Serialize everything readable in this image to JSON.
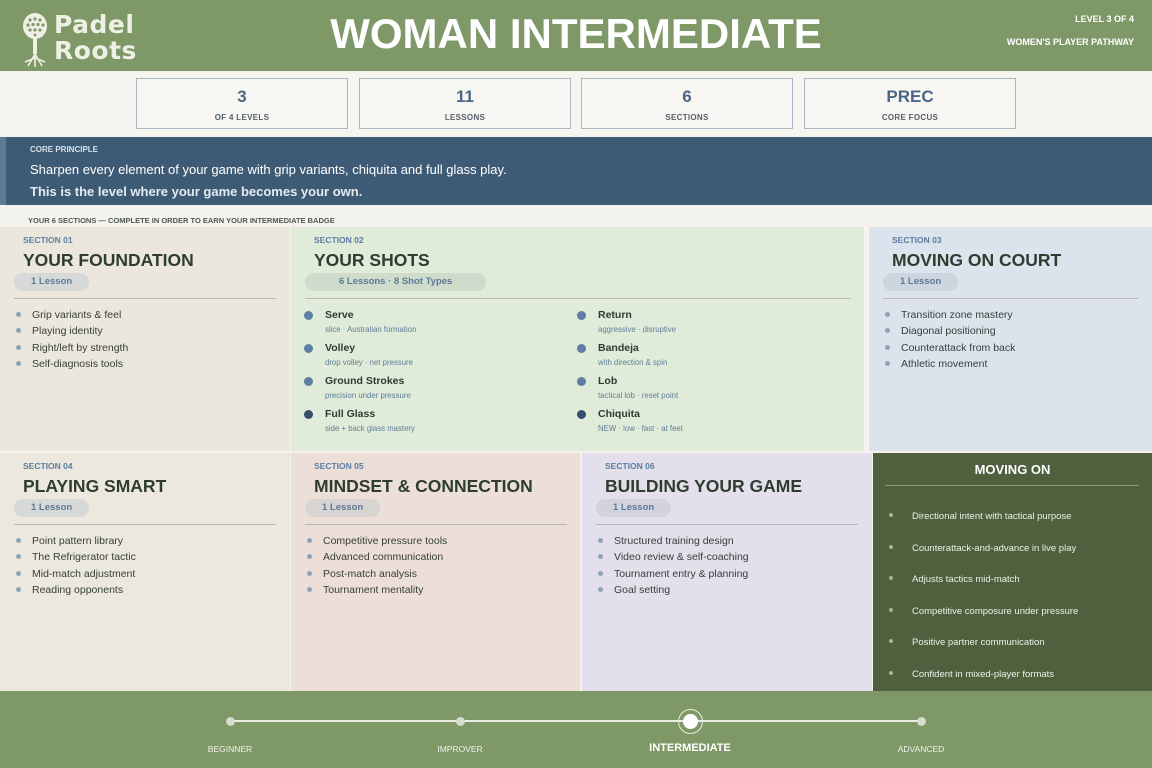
{
  "header": {
    "brand_line1": "Padel",
    "brand_line2": "Roots",
    "title": "WOMAN INTERMEDIATE",
    "level_tag": "LEVEL 3 OF 4",
    "pathway_tag": "WOMEN'S PLAYER PATHWAY"
  },
  "stats": [
    {
      "value": "3",
      "label": "OF 4 LEVELS"
    },
    {
      "value": "11",
      "label": "LESSONS"
    },
    {
      "value": "6",
      "label": "SECTIONS"
    },
    {
      "value": "PREC",
      "label": "CORE FOCUS"
    }
  ],
  "core": {
    "label": "CORE PRINCIPLE",
    "text": "Sharpen every element of your game with grip variants, chiquita and full glass play.",
    "emphasis": "This is the level where your game becomes your own."
  },
  "sections_intro": "YOUR 6 SECTIONS — COMPLETE IN ORDER TO EARN YOUR INTERMEDIATE BADGE",
  "sections": [
    {
      "num": "SECTION 01",
      "title": "YOUR FOUNDATION",
      "lessons": "1 Lesson",
      "items": [
        "Grip variants & feel",
        "Playing identity",
        "Right/left by strength",
        "Self-diagnosis tools"
      ]
    },
    {
      "num": "SECTION 02",
      "title": "YOUR SHOTS",
      "lessons": "6 Lessons · 8 Shot Types",
      "shots": [
        {
          "name": "Serve",
          "note": "slice · Australian formation"
        },
        {
          "name": "Return",
          "note": "aggressive · disruptive"
        },
        {
          "name": "Volley",
          "note": "drop volley · net pressure"
        },
        {
          "name": "Bandeja",
          "note": "with direction & spin"
        },
        {
          "name": "Ground Strokes",
          "note": "precision under pressure"
        },
        {
          "name": "Lob",
          "note": "tactical lob · reset point"
        },
        {
          "name": "Full Glass",
          "note": "side + back glass mastery"
        },
        {
          "name": "Chiquita",
          "note": "NEW · low · fast · at feet"
        }
      ]
    },
    {
      "num": "SECTION 03",
      "title": "MOVING ON COURT",
      "lessons": "1 Lesson",
      "items": [
        "Transition zone mastery",
        "Diagonal positioning",
        "Counterattack from back",
        "Athletic movement"
      ]
    },
    {
      "num": "SECTION 04",
      "title": "PLAYING SMART",
      "lessons": "1 Lesson",
      "items": [
        "Point pattern library",
        "The Refrigerator tactic",
        "Mid-match adjustment",
        "Reading opponents"
      ]
    },
    {
      "num": "SECTION 05",
      "title": "MINDSET & CONNECTION",
      "lessons": "1 Lesson",
      "items": [
        "Competitive pressure tools",
        "Advanced communication",
        "Post-match analysis",
        "Tournament mentality"
      ]
    },
    {
      "num": "SECTION 06",
      "title": "BUILDING YOUR GAME",
      "lessons": "1 Lesson",
      "items": [
        "Structured training design",
        "Video review & self-coaching",
        "Tournament entry & planning",
        "Goal setting"
      ]
    }
  ],
  "moving_on": {
    "title": "MOVING ON",
    "items": [
      "Directional intent with tactical purpose",
      "Counterattack-and-advance in live play",
      "Adjusts tactics mid-match",
      "Competitive composure under pressure",
      "Positive partner communication",
      "Confident in mixed-player formats"
    ]
  },
  "pathway": {
    "stages": [
      "BEGINNER",
      "IMPROVER",
      "INTERMEDIATE",
      "ADVANCED"
    ],
    "current": "INTERMEDIATE"
  },
  "colors": {
    "header_green": "#7f9868",
    "core_blue": "#3e5b75",
    "moving_on_green": "#4f603f",
    "card_foundation": "#ebe7dc",
    "card_shots": "#e1ebd9",
    "card_moving": "#dde3ed",
    "card_smart": "#ece8dd",
    "card_mindset": "#ecdfd8",
    "card_building": "#e3e0eb"
  }
}
